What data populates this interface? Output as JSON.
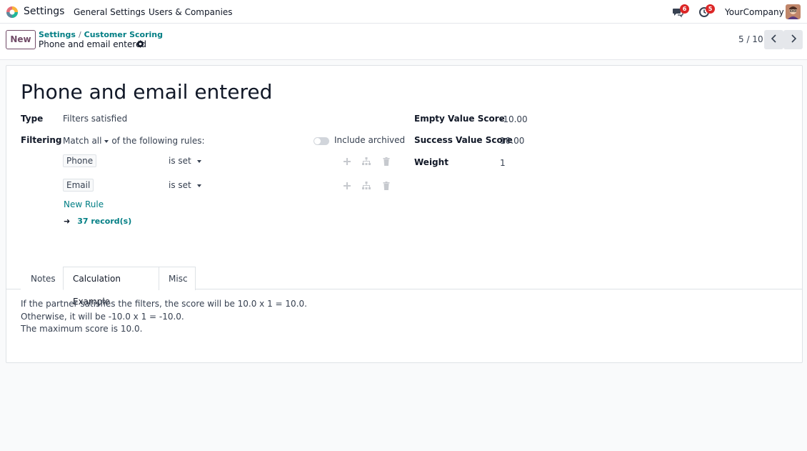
{
  "navbar": {
    "app_name": "Settings",
    "menu": [
      "General Settings",
      "Users & Companies"
    ],
    "messages_count": "6",
    "activities_count": "5",
    "company": "YourCompany"
  },
  "control_panel": {
    "new_label": "New",
    "breadcrumb": [
      "Settings",
      "Customer Scoring"
    ],
    "record_name": "Phone and email entered",
    "pager": "5 / 10"
  },
  "form": {
    "title": "Phone and email entered",
    "type_label": "Type",
    "type_value": "Filters satisfied",
    "filtering_label": "Filtering",
    "match_prefix": "Match",
    "match_value": "all",
    "match_suffix": "of the following rules:",
    "include_archived": "Include archived",
    "rules": [
      {
        "field": "Phone",
        "operator": "is set"
      },
      {
        "field": "Email",
        "operator": "is set"
      }
    ],
    "new_rule": "New Rule",
    "records": "37 record(s)",
    "empty_score_label": "Empty Value Score",
    "empty_score_value": "-10.00",
    "success_score_label": "Success Value Score",
    "success_score_value": "10.00",
    "weight_label": "Weight",
    "weight_value": "1"
  },
  "tabs": {
    "items": [
      "Notes",
      "Calculation Example",
      "Misc"
    ],
    "active": "Calculation Example",
    "content": [
      "If the partner satisfies the filters, the score will be 10.0 x 1 = 10.0.",
      "Otherwise, it will be -10.0 x 1 = -10.0.",
      "The maximum score is 10.0."
    ]
  },
  "colors": {
    "brand": "#714b67",
    "link": "#017e84",
    "badge": "#dc2626"
  }
}
